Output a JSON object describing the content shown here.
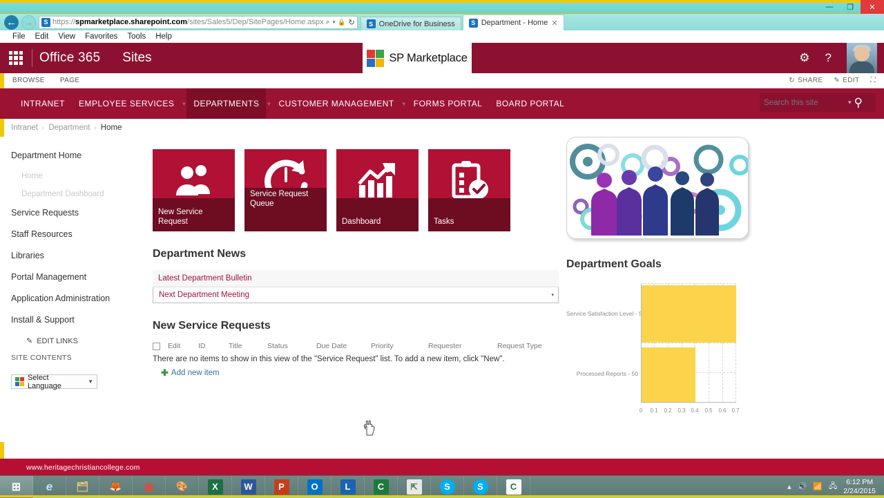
{
  "window": {
    "minimize": "—",
    "restore": "❐",
    "close": "✕"
  },
  "browser": {
    "back_icon": "←",
    "forward_icon": "→",
    "url_prefix": "https://",
    "url_domain": "spmarketplace.sharepoint.com",
    "url_path": "/sites/Sales5/Dep/SitePages/Home.aspx",
    "addr_search_icon": "⌕",
    "addr_caret": "▾",
    "addr_lock_icon": "🔒",
    "addr_refresh_icon": "↻",
    "tabs": [
      {
        "label": "OneDrive for Business",
        "active": false
      },
      {
        "label": "Department - Home",
        "active": true,
        "close": "✕"
      }
    ],
    "menu": [
      "File",
      "Edit",
      "View",
      "Favorites",
      "Tools",
      "Help"
    ]
  },
  "suitebar": {
    "waffle_name": "app-launcher",
    "office_label": "Office 365",
    "sites_label": "Sites",
    "brand_label": "SP Marketplace",
    "settings_icon": "⚙",
    "help_icon": "?"
  },
  "ribbon": {
    "tabs": [
      "BROWSE",
      "PAGE"
    ],
    "share_label": "SHARE",
    "share_icon": "↻",
    "edit_label": "EDIT",
    "edit_icon": "✎",
    "focus_icon": "⛶"
  },
  "topnav": {
    "items": [
      {
        "label": "INTRANET",
        "caret": false,
        "active": false
      },
      {
        "label": "EMPLOYEE SERVICES",
        "caret": true,
        "active": false
      },
      {
        "label": "DEPARTMENTS",
        "caret": true,
        "active": true
      },
      {
        "label": "CUSTOMER MANAGEMENT",
        "caret": true,
        "active": false
      },
      {
        "label": "FORMS PORTAL",
        "caret": false,
        "active": false
      },
      {
        "label": "BOARD PORTAL",
        "caret": false,
        "active": false
      }
    ],
    "caret_glyph": "▿",
    "search_placeholder": "Search this site",
    "search_value": "",
    "search_caret": "▾",
    "search_icon": "⚲"
  },
  "breadcrumb": {
    "items": [
      "Intranet",
      "Department",
      "Home"
    ],
    "separator": "›"
  },
  "sidebar": {
    "items": [
      {
        "label": "Department Home",
        "type": "main"
      },
      {
        "label": "Home",
        "type": "sub"
      },
      {
        "label": "Department Dashboard",
        "type": "sub"
      },
      {
        "label": "Service Requests",
        "type": "main"
      },
      {
        "label": "Staff Resources",
        "type": "main"
      },
      {
        "label": "Libraries",
        "type": "main"
      },
      {
        "label": "Portal Management",
        "type": "main"
      },
      {
        "label": "Application Administration",
        "type": "main"
      },
      {
        "label": "Install & Support",
        "type": "main"
      }
    ],
    "edit_links_label": "EDIT LINKS",
    "edit_links_icon": "✎",
    "site_contents_label": "SITE CONTENTS",
    "language_label": "Select Language",
    "language_caret": "▼"
  },
  "tiles": [
    {
      "label": "New Service Request",
      "icon": "people-icon",
      "tall": false
    },
    {
      "label": "Service Request Queue",
      "icon": "refresh-clock-icon",
      "tall": true
    },
    {
      "label": "Dashboard",
      "icon": "bar-chart-arrow-icon",
      "tall": false
    },
    {
      "label": "Tasks",
      "icon": "clipboard-check-icon",
      "tall": false
    }
  ],
  "news": {
    "heading": "Department News",
    "items": [
      {
        "label": "Latest Department Bulletin",
        "boxed": false
      },
      {
        "label": "Next Department Meeting",
        "boxed": true,
        "caret": "▾"
      }
    ]
  },
  "requests": {
    "heading": "New Service Requests",
    "columns": [
      "Edit",
      "ID",
      "Title",
      "Status",
      "Due Date",
      "Priority",
      "Requester",
      "Request Type"
    ],
    "empty_message": "There are no items to show in this view of the \"Service Request\" list. To add a new item, click \"New\".",
    "add_new_label": "Add new item",
    "add_new_icon": "✚"
  },
  "goals": {
    "heading": "Department Goals"
  },
  "chart_data": {
    "type": "bar",
    "orientation": "horizontal",
    "title": "Department Goals",
    "categories": [
      "Service Satisfaction Level - 5",
      "Processed Reports - 50"
    ],
    "values": [
      0.7,
      0.4
    ],
    "xlabel": "",
    "ylabel": "",
    "xlim": [
      0,
      0.7
    ],
    "xticks": [
      "0",
      "0.1",
      "0.2",
      "0.3",
      "0.4",
      "0.5",
      "0.6",
      "0.7"
    ],
    "xtick_values": [
      0,
      0.1,
      0.2,
      0.3,
      0.4,
      0.5,
      0.6,
      0.7
    ],
    "bar_color": "#fbd44b",
    "grid": true,
    "legend": false
  },
  "footer": {
    "site_url": "www.heritagechristiancollege.com"
  },
  "taskbar": {
    "items": [
      {
        "name": "start-button",
        "glyph": "⊞",
        "bg": "transparent",
        "fg": "#ffffff"
      },
      {
        "name": "internet-explorer-icon",
        "glyph": "e",
        "bg": "transparent",
        "fg": "#bfe4f5"
      },
      {
        "name": "file-explorer-icon",
        "glyph": "🗂",
        "bg": "transparent",
        "fg": "#f2c87a"
      },
      {
        "name": "firefox-icon",
        "glyph": "🦊",
        "bg": "transparent",
        "fg": "#ff8a1e"
      },
      {
        "name": "chrome-icon",
        "glyph": "◉",
        "bg": "transparent",
        "fg": "#dd4b3e"
      },
      {
        "name": "paint-icon",
        "glyph": "🎨",
        "bg": "transparent",
        "fg": "#f3e08a"
      },
      {
        "name": "excel-icon",
        "glyph": "X",
        "bg": "#1d7044",
        "fg": "#ffffff"
      },
      {
        "name": "word-icon",
        "glyph": "W",
        "bg": "#2b579a",
        "fg": "#ffffff"
      },
      {
        "name": "powerpoint-icon",
        "glyph": "P",
        "bg": "#c43e1c",
        "fg": "#ffffff"
      },
      {
        "name": "outlook-icon",
        "glyph": "O",
        "bg": "#0072c6",
        "fg": "#ffffff"
      },
      {
        "name": "lync-icon",
        "glyph": "L",
        "bg": "#1b63b0",
        "fg": "#ffffff"
      },
      {
        "name": "camtasia-icon",
        "glyph": "C",
        "bg": "#1c7a3c",
        "fg": "#ffffff"
      },
      {
        "name": "snagit-icon",
        "glyph": "⇱",
        "bg": "#e8e8e8",
        "fg": "#3a7a3a"
      },
      {
        "name": "skype-icon",
        "glyph": "S",
        "bg": "#00aff0",
        "fg": "#ffffff"
      },
      {
        "name": "skype-business-icon",
        "glyph": "S",
        "bg": "#00aff0",
        "fg": "#ffffff"
      },
      {
        "name": "camtasia-studio-icon",
        "glyph": "C",
        "bg": "#ffffff",
        "fg": "#1c7a3c"
      }
    ],
    "tray_icons": [
      "▴",
      "🔊",
      "📶",
      "🖧"
    ],
    "clock_time": "6:12 PM",
    "clock_date": "2/24/2015"
  }
}
